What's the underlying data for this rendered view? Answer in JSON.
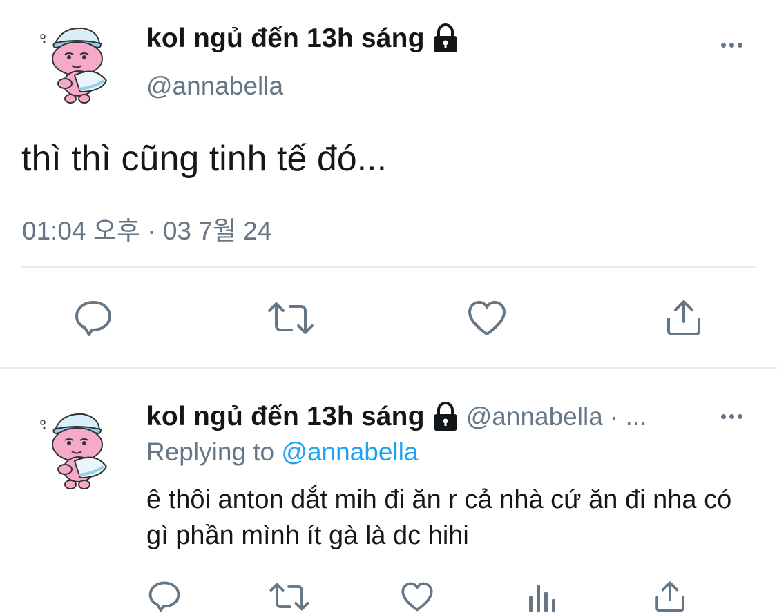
{
  "tweet": {
    "display_name": "kol ngủ đến 13h sáng",
    "handle": "@annabella",
    "text": "thì thì cũng tinh tế đó...",
    "timestamp": "01:04 오후 · 03 7월 24",
    "avatar_icon": "sleepy-pink-character-avatar",
    "lock_icon": "lock-icon",
    "actions": [
      "reply-icon",
      "retweet-icon",
      "like-icon",
      "share-icon"
    ]
  },
  "reply": {
    "display_name": "kol ngủ đến 13h sáng",
    "handle_meta": "@annabella · ...",
    "replying_to_label": "Replying to",
    "replying_to_handle": "@annabella",
    "text": "ê thôi anton dắt mih đi ăn r cả nhà cứ ăn đi nha có gì phần mình ít gà là dc hihi",
    "actions": [
      "reply-icon",
      "retweet-icon",
      "like-icon",
      "analytics-icon",
      "share-icon"
    ]
  },
  "colors": {
    "text_primary": "#14171a",
    "text_secondary": "#657786",
    "link": "#1da1f2",
    "divider": "#e6ecf0"
  }
}
